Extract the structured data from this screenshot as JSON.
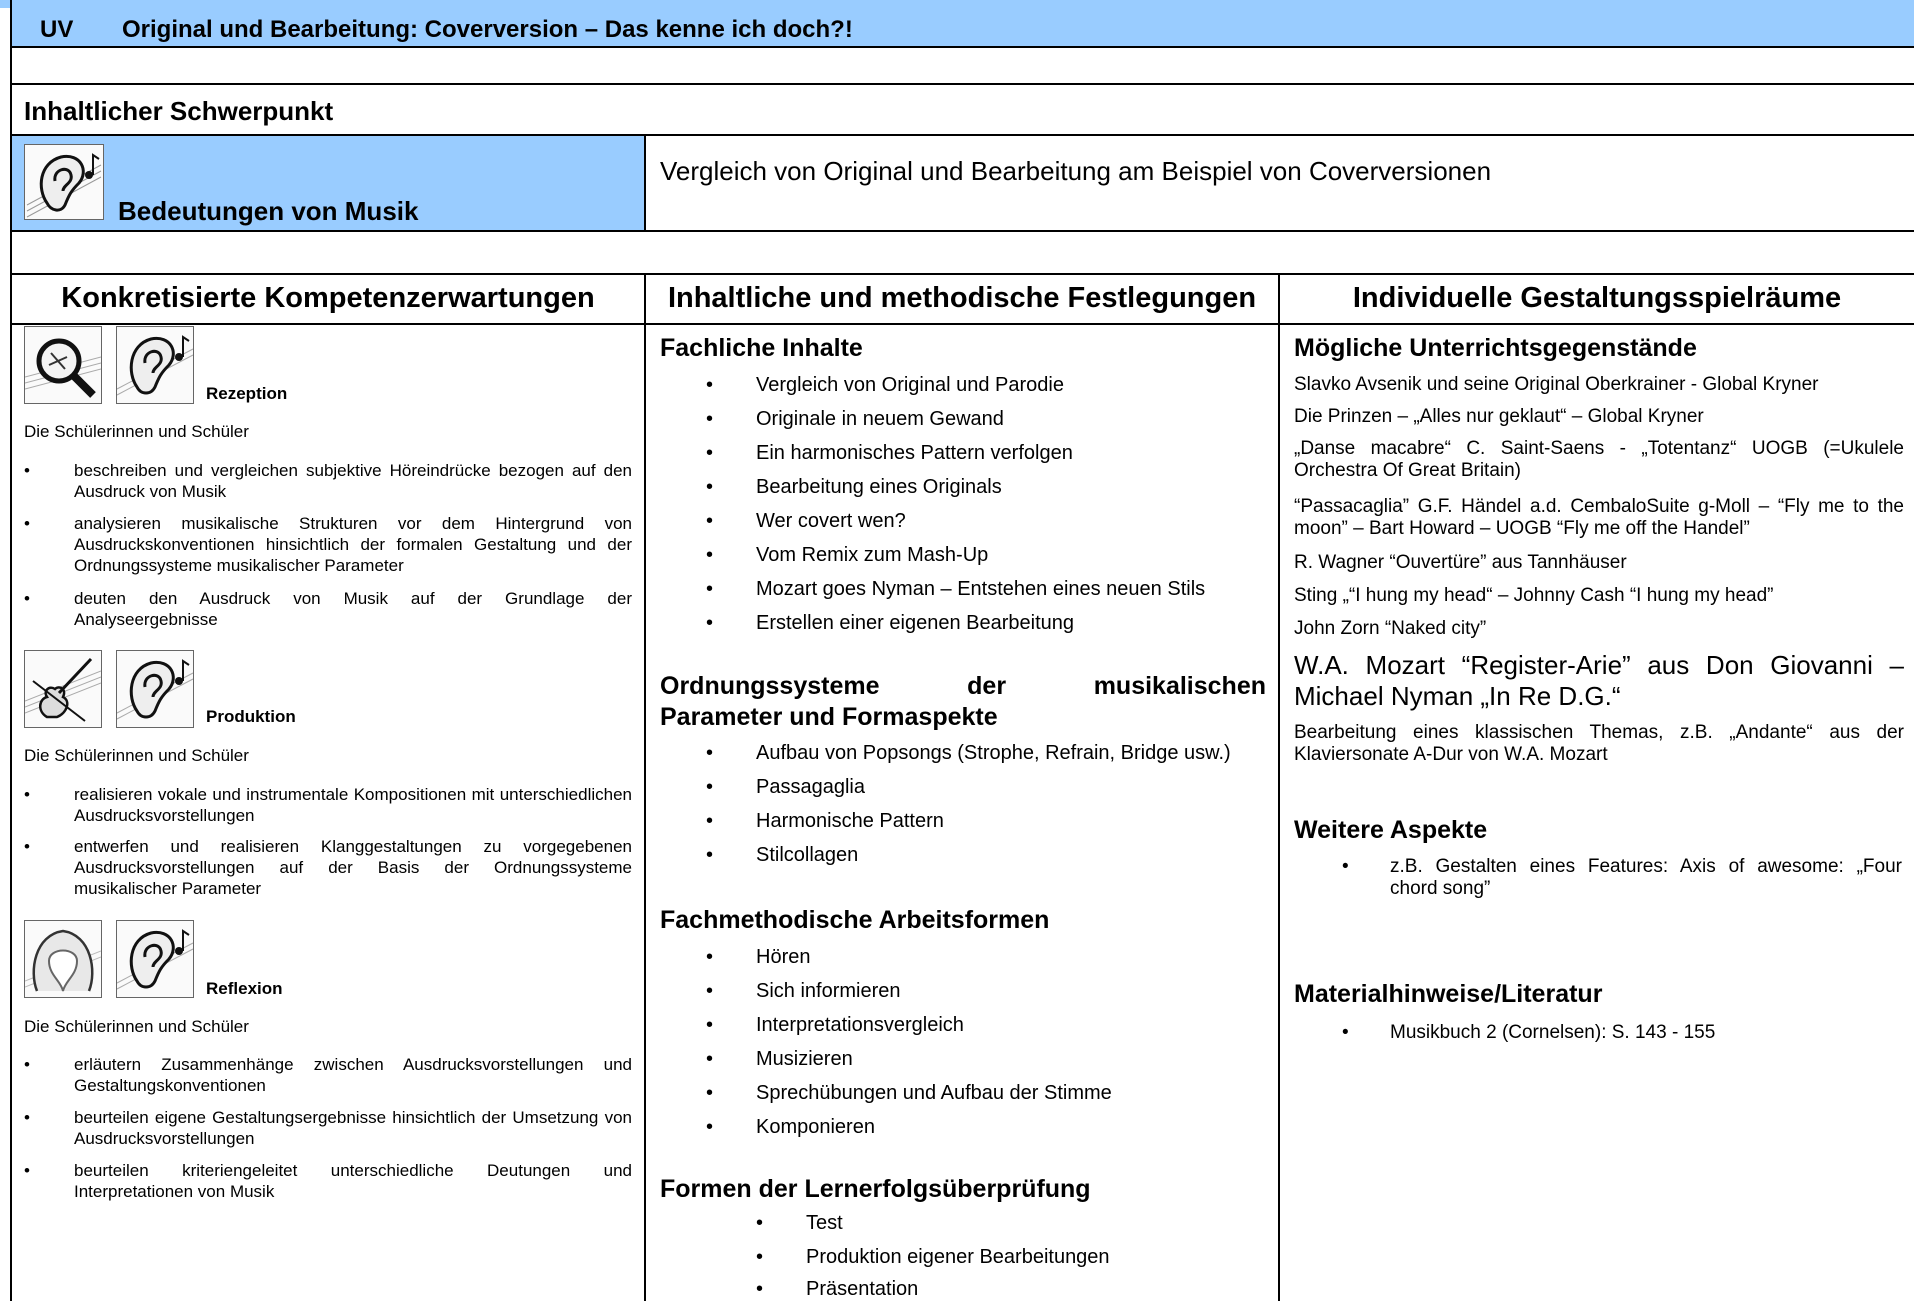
{
  "header": {
    "uv_label": "UV",
    "title": "Original und Bearbeitung: Coverversion – Das kenne ich doch?!"
  },
  "focus": {
    "section_title": "Inhaltlicher Schwerpunkt",
    "label": "Bedeutungen von Musik",
    "description": "Vergleich von Original und Bearbeitung am Beispiel von Coverversionen"
  },
  "columns": [
    "Konkretisierte Kompetenzerwartungen",
    "Inhaltliche und methodische Festlegungen",
    "Individuelle Gestaltungsspielräume"
  ],
  "competences": {
    "intro": "Die Schülerinnen und Schüler",
    "blocks": [
      {
        "label": "Rezeption",
        "items": [
          "beschreiben und vergleichen subjektive Höreindrücke bezogen auf den Ausdruck von Musik",
          "analysieren musikalische Strukturen vor dem Hintergrund von Ausdruckskonventionen hinsichtlich der formalen Gestaltung und der Ordnungssysteme musikalischer Parameter",
          "deuten den Ausdruck von Musik auf der Grundlage der Analyseergebnisse"
        ]
      },
      {
        "label": "Produktion",
        "items": [
          "realisieren vokale und instrumentale Kompositionen mit unterschiedlichen Ausdrucksvorstellungen",
          "entwerfen und realisieren Klanggestaltungen zu vorgegebenen Ausdrucksvorstellungen auf der Basis der Ordnungssysteme musikalischer Parameter"
        ]
      },
      {
        "label": "Reflexion",
        "items": [
          "erläutern Zusammenhänge zwischen Ausdrucksvorstellungen und Gestaltungskonventionen",
          "beurteilen eigene Gestaltungsergebnisse hinsichtlich der Umsetzung von Ausdrucksvorstellungen",
          "beurteilen kriteriengeleitet unterschiedliche Deutungen und Interpretationen von Musik"
        ]
      }
    ]
  },
  "contents": {
    "fachliche_title": "Fachliche Inhalte",
    "fachliche": [
      "Vergleich von Original und Parodie",
      "Originale in neuem Gewand",
      "Ein harmonisches Pattern verfolgen",
      "Bearbeitung eines Originals",
      "Wer covert wen?",
      "Vom Remix zum Mash-Up",
      "Mozart goes Nyman – Entstehen eines neuen Stils",
      "Erstellen einer eigenen Bearbeitung"
    ],
    "ordnung_title_1": "Ordnungssysteme der musikalischen",
    "ordnung_title_2": "Parameter und Formaspekte",
    "ordnung": [
      "Aufbau von Popsongs (Strophe, Refrain, Bridge usw.)",
      "Passagaglia",
      "Harmonische Pattern",
      "Stilcollagen"
    ],
    "methoden_title": "Fachmethodische Arbeitsformen",
    "methoden": [
      "Hören",
      "Sich informieren",
      "Interpretationsvergleich",
      "Musizieren",
      "Sprechübungen und Aufbau der Stimme",
      "Komponieren"
    ],
    "lernerfolg_title": "Formen der Lernerfolgsüberprüfung",
    "lernerfolg": [
      "Test",
      "Produktion eigener Bearbeitungen",
      "Präsentation"
    ]
  },
  "individual": {
    "title": "Mögliche Unterrichtsgegenstände",
    "items": [
      "Slavko Avsenik und seine Original Oberkrainer - Global Kryner",
      "Die Prinzen – „Alles nur geklaut“ – Global Kryner",
      "„Danse macabre“ C. Saint-Saens - „Totentanz“ UOGB (=Ukulele Orchestra Of Great Britain)",
      "“Passacaglia” G.F. Händel a.d. CembaloSuite g-Moll – “Fly me to the moon” – Bart Howard – UOGB “Fly me off the Handel”",
      "R. Wagner “Ouvertüre” aus Tannhäuser",
      "Sting „“I hung my head“ – Johnny Cash “I hung my head”",
      "John Zorn “Naked city”"
    ],
    "big_item": "W.A. Mozart “Register-Arie” aus Don Giovanni – Michael Nyman „In Re D.G.“",
    "last_item": "Bearbeitung eines klassischen Themas, z.B. „Andante“ aus der Klaviersonate A-Dur von W.A. Mozart",
    "weitere_title": "Weitere Aspekte",
    "weitere": [
      "z.B. Gestalten eines Features: Axis of awesome: „Four chord song”"
    ],
    "material_title": "Materialhinweise/Literatur",
    "material": [
      "Musikbuch 2 (Cornelsen): S. 143 - 155"
    ]
  }
}
